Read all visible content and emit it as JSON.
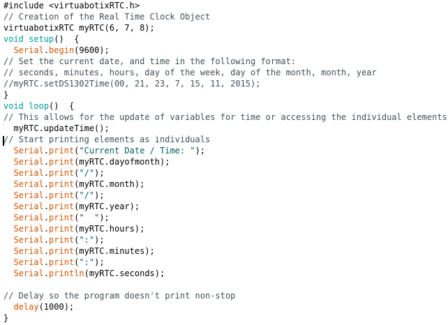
{
  "editor": {
    "lines": [
      [
        {
          "t": "#include <virtuabotixRTC.h>",
          "c": "default"
        }
      ],
      [
        {
          "t": "// Creation of the Real Time Clock Object",
          "c": "comment"
        }
      ],
      [
        {
          "t": "virtuabotixRTC myRTC(6, 7, 8);",
          "c": "default"
        }
      ],
      [
        {
          "t": "void",
          "c": "keyword"
        },
        {
          "t": " ",
          "c": "default"
        },
        {
          "t": "setup",
          "c": "keyword"
        },
        {
          "t": "()  {",
          "c": "default"
        }
      ],
      [
        {
          "t": "  ",
          "c": "default"
        },
        {
          "t": "Serial",
          "c": "func"
        },
        {
          "t": ".",
          "c": "default"
        },
        {
          "t": "begin",
          "c": "func"
        },
        {
          "t": "(9600);",
          "c": "default"
        }
      ],
      [
        {
          "t": "// Set the current date, and time in the following format:",
          "c": "comment"
        }
      ],
      [
        {
          "t": "// seconds, minutes, hours, day of the week, day of the month, month, year",
          "c": "comment"
        }
      ],
      [
        {
          "t": "//myRTC.setDS1302Time(00, 21, 23, 7, 15, 11, 2015);",
          "c": "comment"
        }
      ],
      [
        {
          "t": "}",
          "c": "default"
        }
      ],
      [
        {
          "t": "void",
          "c": "keyword"
        },
        {
          "t": " ",
          "c": "default"
        },
        {
          "t": "loop",
          "c": "keyword"
        },
        {
          "t": "()  {",
          "c": "default"
        }
      ],
      [
        {
          "t": "// This allows for the update of variables for time or accessing the individual elements.",
          "c": "comment"
        }
      ],
      [
        {
          "t": "  myRTC.updateTime();",
          "c": "default"
        }
      ],
      [
        {
          "t": "// Start printing elements as individuals",
          "c": "comment"
        }
      ],
      [
        {
          "t": "  ",
          "c": "default"
        },
        {
          "t": "Serial",
          "c": "func"
        },
        {
          "t": ".",
          "c": "default"
        },
        {
          "t": "print",
          "c": "func"
        },
        {
          "t": "(",
          "c": "default"
        },
        {
          "t": "\"Current Date / Time: \"",
          "c": "str"
        },
        {
          "t": ");",
          "c": "default"
        }
      ],
      [
        {
          "t": "  ",
          "c": "default"
        },
        {
          "t": "Serial",
          "c": "func"
        },
        {
          "t": ".",
          "c": "default"
        },
        {
          "t": "print",
          "c": "func"
        },
        {
          "t": "(myRTC.dayofmonth);",
          "c": "default"
        }
      ],
      [
        {
          "t": "  ",
          "c": "default"
        },
        {
          "t": "Serial",
          "c": "func"
        },
        {
          "t": ".",
          "c": "default"
        },
        {
          "t": "print",
          "c": "func"
        },
        {
          "t": "(",
          "c": "default"
        },
        {
          "t": "\"/\"",
          "c": "str"
        },
        {
          "t": ");",
          "c": "default"
        }
      ],
      [
        {
          "t": "  ",
          "c": "default"
        },
        {
          "t": "Serial",
          "c": "func"
        },
        {
          "t": ".",
          "c": "default"
        },
        {
          "t": "print",
          "c": "func"
        },
        {
          "t": "(myRTC.month);",
          "c": "default"
        }
      ],
      [
        {
          "t": "  ",
          "c": "default"
        },
        {
          "t": "Serial",
          "c": "func"
        },
        {
          "t": ".",
          "c": "default"
        },
        {
          "t": "print",
          "c": "func"
        },
        {
          "t": "(",
          "c": "default"
        },
        {
          "t": "\"/\"",
          "c": "str"
        },
        {
          "t": ");",
          "c": "default"
        }
      ],
      [
        {
          "t": "  ",
          "c": "default"
        },
        {
          "t": "Serial",
          "c": "func"
        },
        {
          "t": ".",
          "c": "default"
        },
        {
          "t": "print",
          "c": "func"
        },
        {
          "t": "(myRTC.year);",
          "c": "default"
        }
      ],
      [
        {
          "t": "  ",
          "c": "default"
        },
        {
          "t": "Serial",
          "c": "func"
        },
        {
          "t": ".",
          "c": "default"
        },
        {
          "t": "print",
          "c": "func"
        },
        {
          "t": "(",
          "c": "default"
        },
        {
          "t": "\"  \"",
          "c": "str"
        },
        {
          "t": ");",
          "c": "default"
        }
      ],
      [
        {
          "t": "  ",
          "c": "default"
        },
        {
          "t": "Serial",
          "c": "func"
        },
        {
          "t": ".",
          "c": "default"
        },
        {
          "t": "print",
          "c": "func"
        },
        {
          "t": "(myRTC.hours);",
          "c": "default"
        }
      ],
      [
        {
          "t": "  ",
          "c": "default"
        },
        {
          "t": "Serial",
          "c": "func"
        },
        {
          "t": ".",
          "c": "default"
        },
        {
          "t": "print",
          "c": "func"
        },
        {
          "t": "(",
          "c": "default"
        },
        {
          "t": "\":\"",
          "c": "str"
        },
        {
          "t": ");",
          "c": "default"
        }
      ],
      [
        {
          "t": "  ",
          "c": "default"
        },
        {
          "t": "Serial",
          "c": "func"
        },
        {
          "t": ".",
          "c": "default"
        },
        {
          "t": "print",
          "c": "func"
        },
        {
          "t": "(myRTC.minutes);",
          "c": "default"
        }
      ],
      [
        {
          "t": "  ",
          "c": "default"
        },
        {
          "t": "Serial",
          "c": "func"
        },
        {
          "t": ".",
          "c": "default"
        },
        {
          "t": "print",
          "c": "func"
        },
        {
          "t": "(",
          "c": "default"
        },
        {
          "t": "\":\"",
          "c": "str"
        },
        {
          "t": ");",
          "c": "default"
        }
      ],
      [
        {
          "t": "  ",
          "c": "default"
        },
        {
          "t": "Serial",
          "c": "func"
        },
        {
          "t": ".",
          "c": "default"
        },
        {
          "t": "println",
          "c": "func"
        },
        {
          "t": "(myRTC.seconds);",
          "c": "default"
        }
      ],
      [
        {
          "t": "",
          "c": "default"
        }
      ],
      [
        {
          "t": "// Delay so the program doesn't print non-stop",
          "c": "comment"
        }
      ],
      [
        {
          "t": "  ",
          "c": "default"
        },
        {
          "t": "delay",
          "c": "func"
        },
        {
          "t": "(1000);",
          "c": "default"
        }
      ],
      [
        {
          "t": "}",
          "c": "default"
        }
      ]
    ]
  }
}
